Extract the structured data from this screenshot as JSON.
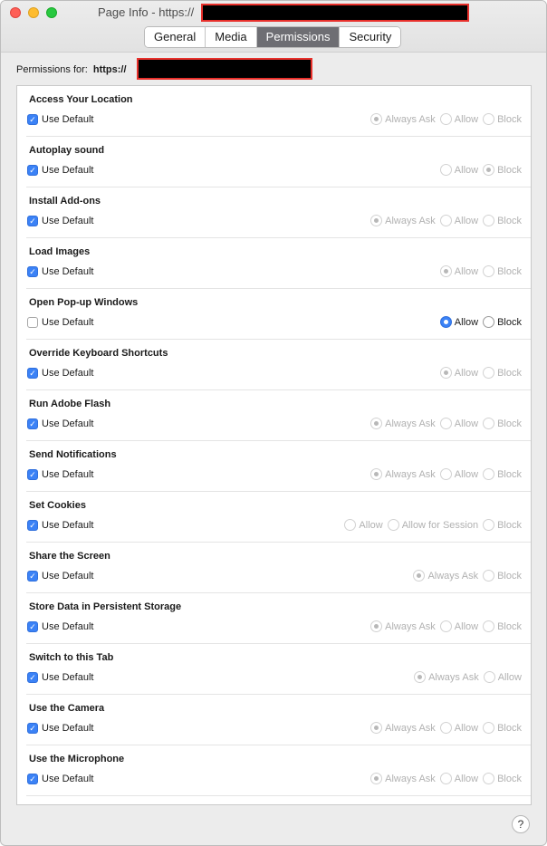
{
  "window": {
    "title": "Page Info - https://"
  },
  "tabs": [
    {
      "label": "General",
      "active": false
    },
    {
      "label": "Media",
      "active": false
    },
    {
      "label": "Permissions",
      "active": true
    },
    {
      "label": "Security",
      "active": false
    }
  ],
  "permissions_for": {
    "label": "Permissions for:",
    "url": "https://"
  },
  "rows": [
    {
      "name": "Access Your Location",
      "use_default": true,
      "use_default_label": "Use Default",
      "options": [
        {
          "label": "Always Ask",
          "selected": true
        },
        {
          "label": "Allow",
          "selected": false
        },
        {
          "label": "Block",
          "selected": false
        }
      ]
    },
    {
      "name": "Autoplay sound",
      "use_default": true,
      "use_default_label": "Use Default",
      "options": [
        {
          "label": "Allow",
          "selected": false
        },
        {
          "label": "Block",
          "selected": true
        }
      ]
    },
    {
      "name": "Install Add-ons",
      "use_default": true,
      "use_default_label": "Use Default",
      "options": [
        {
          "label": "Always Ask",
          "selected": true
        },
        {
          "label": "Allow",
          "selected": false
        },
        {
          "label": "Block",
          "selected": false
        }
      ]
    },
    {
      "name": "Load Images",
      "use_default": true,
      "use_default_label": "Use Default",
      "options": [
        {
          "label": "Allow",
          "selected": true
        },
        {
          "label": "Block",
          "selected": false
        }
      ]
    },
    {
      "name": "Open Pop-up Windows",
      "use_default": false,
      "use_default_label": "Use Default",
      "options": [
        {
          "label": "Allow",
          "selected": true
        },
        {
          "label": "Block",
          "selected": false
        }
      ]
    },
    {
      "name": "Override Keyboard Shortcuts",
      "use_default": true,
      "use_default_label": "Use Default",
      "options": [
        {
          "label": "Allow",
          "selected": true
        },
        {
          "label": "Block",
          "selected": false
        }
      ]
    },
    {
      "name": "Run Adobe Flash",
      "use_default": true,
      "use_default_label": "Use Default",
      "options": [
        {
          "label": "Always Ask",
          "selected": true
        },
        {
          "label": "Allow",
          "selected": false
        },
        {
          "label": "Block",
          "selected": false
        }
      ]
    },
    {
      "name": "Send Notifications",
      "use_default": true,
      "use_default_label": "Use Default",
      "options": [
        {
          "label": "Always Ask",
          "selected": true
        },
        {
          "label": "Allow",
          "selected": false
        },
        {
          "label": "Block",
          "selected": false
        }
      ]
    },
    {
      "name": "Set Cookies",
      "use_default": true,
      "use_default_label": "Use Default",
      "options": [
        {
          "label": "Allow",
          "selected": false
        },
        {
          "label": "Allow for Session",
          "selected": false
        },
        {
          "label": "Block",
          "selected": false
        }
      ]
    },
    {
      "name": "Share the Screen",
      "use_default": true,
      "use_default_label": "Use Default",
      "options": [
        {
          "label": "Always Ask",
          "selected": true
        },
        {
          "label": "Block",
          "selected": false
        }
      ]
    },
    {
      "name": "Store Data in Persistent Storage",
      "use_default": true,
      "use_default_label": "Use Default",
      "options": [
        {
          "label": "Always Ask",
          "selected": true
        },
        {
          "label": "Allow",
          "selected": false
        },
        {
          "label": "Block",
          "selected": false
        }
      ]
    },
    {
      "name": "Switch to this Tab",
      "use_default": true,
      "use_default_label": "Use Default",
      "options": [
        {
          "label": "Always Ask",
          "selected": true
        },
        {
          "label": "Allow",
          "selected": false
        }
      ]
    },
    {
      "name": "Use the Camera",
      "use_default": true,
      "use_default_label": "Use Default",
      "options": [
        {
          "label": "Always Ask",
          "selected": true
        },
        {
          "label": "Allow",
          "selected": false
        },
        {
          "label": "Block",
          "selected": false
        }
      ]
    },
    {
      "name": "Use the Microphone",
      "use_default": true,
      "use_default_label": "Use Default",
      "options": [
        {
          "label": "Always Ask",
          "selected": true
        },
        {
          "label": "Allow",
          "selected": false
        },
        {
          "label": "Block",
          "selected": false
        }
      ]
    }
  ],
  "help": {
    "label": "?"
  },
  "colors": {
    "accent": "#3b82f6",
    "redaction_border": "#e8302b",
    "active_tab": "#6e6e73"
  }
}
